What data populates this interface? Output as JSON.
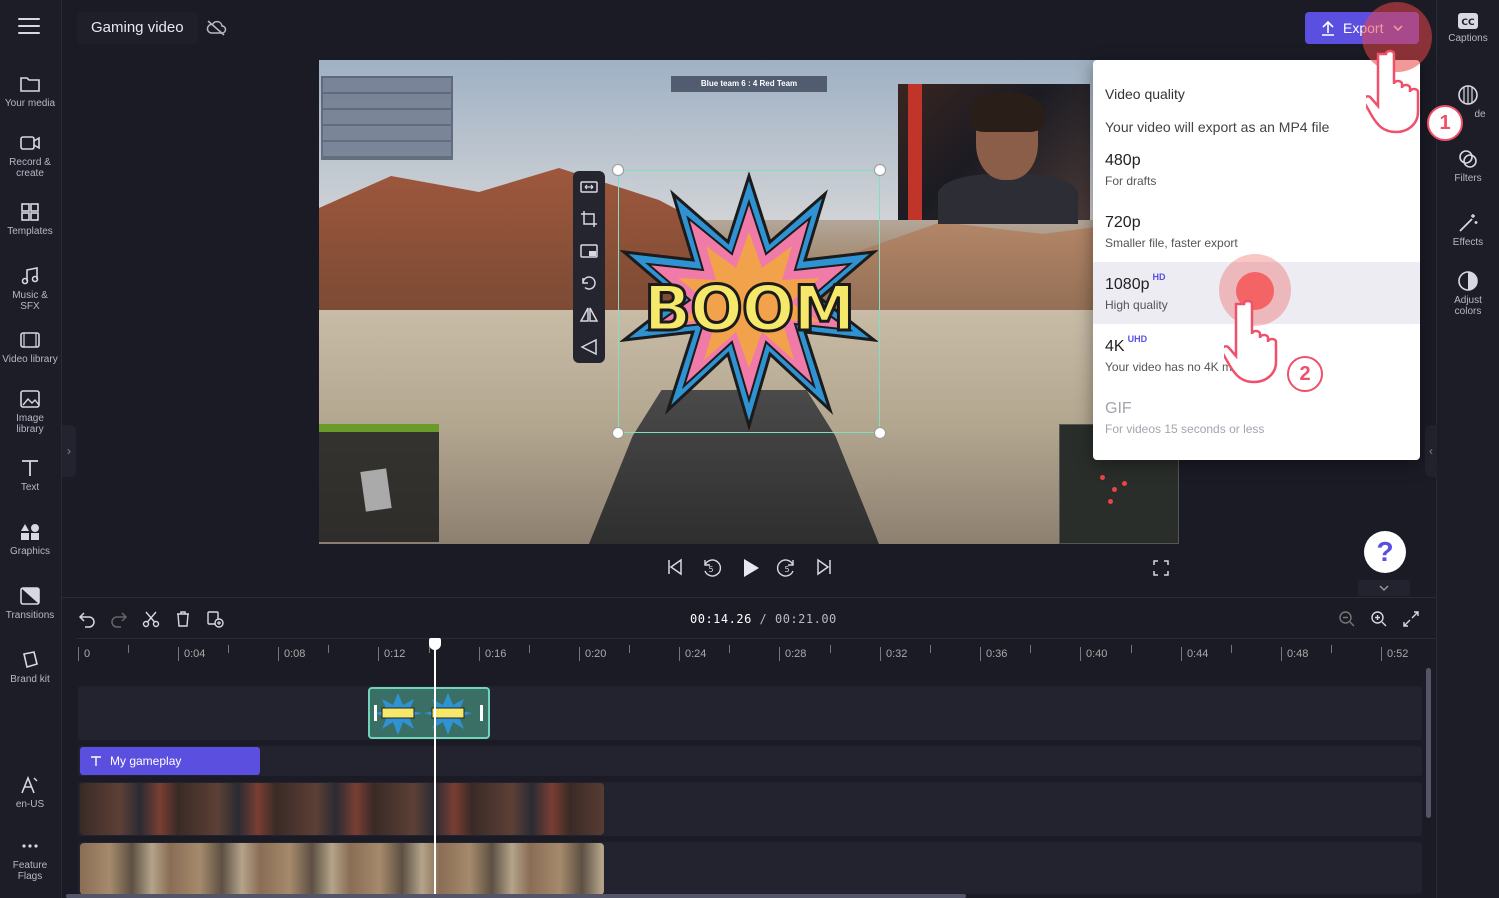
{
  "app": {
    "project_title": "Gaming video",
    "export_label": "Export",
    "accent": "#5b4fe0"
  },
  "left_sidebar": [
    {
      "label": "Your media",
      "icon": "folder-icon"
    },
    {
      "label": "Record & create",
      "icon": "camera-icon"
    },
    {
      "label": "Templates",
      "icon": "templates-icon"
    },
    {
      "label": "Music & SFX",
      "icon": "music-icon"
    },
    {
      "label": "Video library",
      "icon": "video-library-icon"
    },
    {
      "label": "Image library",
      "icon": "image-icon"
    },
    {
      "label": "Text",
      "icon": "text-icon"
    },
    {
      "label": "Graphics",
      "icon": "graphics-icon"
    },
    {
      "label": "Transitions",
      "icon": "transitions-icon"
    },
    {
      "label": "Brand kit",
      "icon": "brand-kit-icon"
    },
    {
      "label": "en-US",
      "icon": "language-icon"
    },
    {
      "label": "Feature Flags",
      "icon": "more-icon"
    }
  ],
  "right_sidebar": [
    {
      "label": "Captions",
      "icon": "captions-icon"
    },
    {
      "label": "de",
      "icon": "fade-icon"
    },
    {
      "label": "Filters",
      "icon": "filters-icon"
    },
    {
      "label": "Effects",
      "icon": "effects-icon"
    },
    {
      "label": "Adjust colors",
      "icon": "adjust-colors-icon"
    }
  ],
  "preview": {
    "team_score": "Blue team 6 : 4 Red Team",
    "sticker_text": "BOOM"
  },
  "export_menu": {
    "heading": "Video quality",
    "subtitle": "Your video will export as an MP4 file",
    "options": [
      {
        "title": "480p",
        "badge": "",
        "desc": "For drafts",
        "state": "normal"
      },
      {
        "title": "720p",
        "badge": "",
        "desc": "Smaller file, faster export",
        "state": "normal"
      },
      {
        "title": "1080p",
        "badge": "HD",
        "desc": "High quality",
        "state": "active"
      },
      {
        "title": "4K",
        "badge": "UHD",
        "desc": "Your video has no 4K medi",
        "state": "normal"
      },
      {
        "title": "GIF",
        "badge": "",
        "desc": "For videos 15 seconds or less",
        "state": "disabled"
      }
    ]
  },
  "steps": {
    "one": "1",
    "two": "2"
  },
  "help": {
    "label": "?"
  },
  "timeline": {
    "current_time": "00:14.26",
    "total_time": "/ 00:21.00",
    "ticks": [
      "0",
      "0:04",
      "0:08",
      "0:12",
      "0:16",
      "0:20",
      "0:24",
      "0:28",
      "0:32",
      "0:36",
      "0:40",
      "0:44",
      "0:48",
      "0:52"
    ],
    "text_clip_label": "My gameplay"
  }
}
